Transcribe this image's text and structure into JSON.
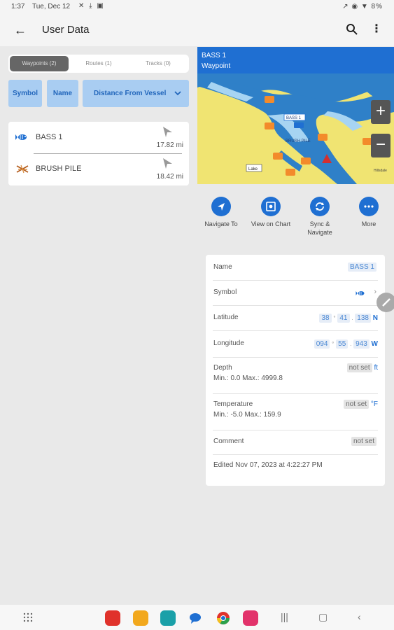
{
  "status": {
    "time": "1:37",
    "date": "Tue, Dec 12",
    "right": "↗ ◉ ▼ 8%"
  },
  "appbar": {
    "title": "User Data",
    "icons": [
      "back-arrow-icon",
      "search-icon",
      "more-vert-icon"
    ]
  },
  "tabs": [
    {
      "label": "Waypoints (2)",
      "active": true
    },
    {
      "label": "Routes (1)",
      "active": false
    },
    {
      "label": "Tracks (0)",
      "active": false
    }
  ],
  "sort": {
    "symbol": "Symbol",
    "name": "Name",
    "distance": "Distance From Vessel",
    "chevron": "⌵"
  },
  "waypoints": [
    {
      "name": "BASS 1",
      "distance": "17.82 mi",
      "icon": "fish-icon"
    },
    {
      "name": "BRUSH PILE",
      "distance": "18.42 mi",
      "icon": "brush-pile-icon"
    }
  ],
  "map": {
    "title": "BASS 1",
    "subtitle": "Waypoint",
    "labels": {
      "bass": "BASS 1",
      "brush": "BRUSH PILE",
      "small": "Lake",
      "hill": "Hillsdale"
    },
    "zoom_in": "+",
    "zoom_out": "−",
    "colors": {
      "land": "#f0e472",
      "water": "#2f80c8",
      "shallow": "#a7d4f2"
    }
  },
  "actions": [
    {
      "label": "Navigate To",
      "icon": "navigate-icon"
    },
    {
      "label": "View on Chart",
      "icon": "chart-icon"
    },
    {
      "label": "Sync & Navigate",
      "icon": "sync-icon"
    },
    {
      "label": "More",
      "icon": "more-horiz-icon"
    }
  ],
  "details": {
    "name_label": "Name",
    "name_value": "BASS 1",
    "symbol_label": "Symbol",
    "latitude_label": "Latitude",
    "lat": {
      "deg": "38",
      "min": "41",
      "sec": "138",
      "hem": "N"
    },
    "longitude_label": "Longitude",
    "lon": {
      "deg": "094",
      "min": "55",
      "sec": "943",
      "hem": "W"
    },
    "depth_label": "Depth",
    "depth_range": "Min.: 0.0 Max.: 4999.8",
    "depth_value": "not set",
    "depth_unit": "ft",
    "temp_label": "Temperature",
    "temp_range": "Min.: -5.0 Max.: 159.9",
    "temp_value": "not set",
    "temp_unit": "°F",
    "comment_label": "Comment",
    "comment_value": "not set",
    "edited": "Edited Nov 07, 2023 at 4:22:27 PM"
  },
  "accent": "#1f6fd2"
}
